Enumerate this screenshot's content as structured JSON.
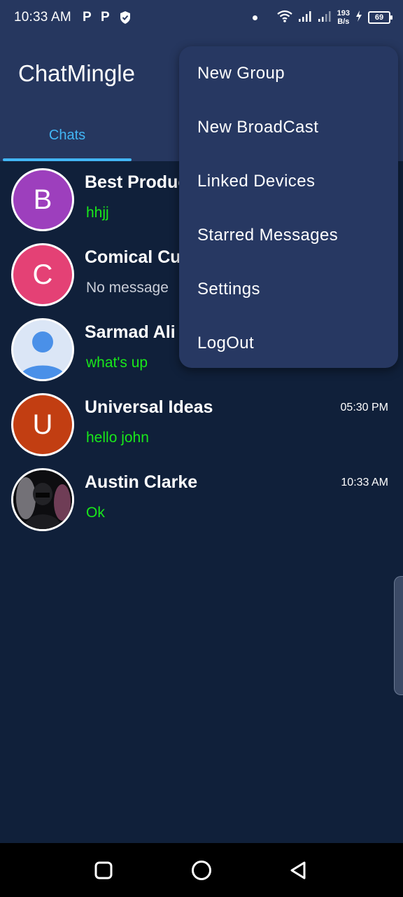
{
  "status_bar": {
    "time": "10:33 AM",
    "left_icons": [
      "P",
      "P"
    ],
    "shield_icon": "shield-check-icon",
    "net_speed_value": "193",
    "net_speed_unit": "B/s",
    "battery": "69",
    "icons": [
      "dot-icon",
      "wifi-icon",
      "signal-icon",
      "signal-icon",
      "charging-icon",
      "battery-icon"
    ]
  },
  "app_bar": {
    "title": "ChatMingle",
    "tabs": [
      {
        "label": "Chats",
        "active": true
      }
    ],
    "accent_color": "#42b6f5",
    "background_color": "#26375f"
  },
  "chats": [
    {
      "name": "Best Produc",
      "message": "hhjj",
      "time": "",
      "avatar_letter": "B",
      "avatar_color": "#9d3fbd",
      "message_color": "green"
    },
    {
      "name": "Comical Cu",
      "message": "No message",
      "time": "",
      "avatar_letter": "C",
      "avatar_color": "#e44175",
      "message_color": "grey"
    },
    {
      "name": "Sarmad Ali",
      "message": "what's up",
      "time": "",
      "avatar_letter": "",
      "avatar_color": "#dbe6f6",
      "message_color": "green"
    },
    {
      "name": "Universal Ideas",
      "message": "hello john",
      "time": "05:30 PM",
      "avatar_letter": "U",
      "avatar_color": "#c23e12",
      "message_color": "green"
    },
    {
      "name": "Austin Clarke",
      "message": "Ok",
      "time": "10:33 AM",
      "avatar_letter": "",
      "avatar_color": "#111111",
      "message_color": "green"
    }
  ],
  "menu": {
    "items": [
      {
        "label": "New Group"
      },
      {
        "label": "New BroadCast"
      },
      {
        "label": "Linked Devices"
      },
      {
        "label": "Starred Messages"
      },
      {
        "label": "Settings"
      },
      {
        "label": "LogOut"
      }
    ]
  },
  "nav_bar": {
    "buttons": [
      "recents-square-icon",
      "home-circle-icon",
      "back-triangle-icon"
    ]
  }
}
